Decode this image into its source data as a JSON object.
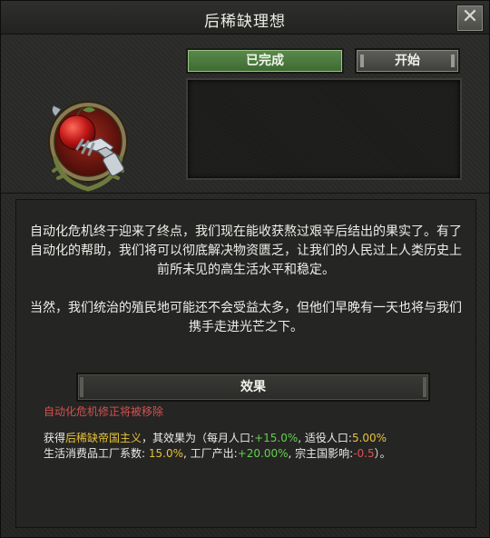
{
  "window": {
    "title": "后稀缺理想"
  },
  "buttons": {
    "completed_label": "已完成",
    "start_label": "开始",
    "close_icon": "close-icon"
  },
  "emblem": {
    "icon": "apple-robotic-hand-emblem"
  },
  "description": {
    "paragraph_1": "自动化危机终于迎来了终点，我们现在能收获熬过艰辛后结出的果实了。有了自动化的帮助，我们将可以彻底解决物资匮乏，让我们的人民过上人类历史上前所未见的高生活水平和稳定。",
    "paragraph_2": "当然，我们统治的殖民地可能还不会受益太多，但他们早晚有一天也将与我们携手走进光芒之下。"
  },
  "effects": {
    "header": "效果",
    "removed_note": "自动化危机修正将被移除",
    "intro": "获得",
    "modifier_name": "后稀缺帝国主义",
    "effect_is": "，其效果为（每月人口:",
    "monthly_pop": "+15.0%",
    "recruitable_label": ", 适役人口:",
    "recruitable": "5.00%",
    "consumer_label": "生活消费品工厂系数:",
    "consumer": "15.0%",
    "factory_label": ", 工厂产出:",
    "factory": "+20.00%",
    "overlord_label": ", 宗主国影响:",
    "overlord": "-0.5",
    "end": "）。"
  },
  "colors": {
    "completed_green": "#4f7e41",
    "removed_red": "#d25252",
    "value_yellow": "#e6c23a",
    "value_green": "#63d04f"
  }
}
